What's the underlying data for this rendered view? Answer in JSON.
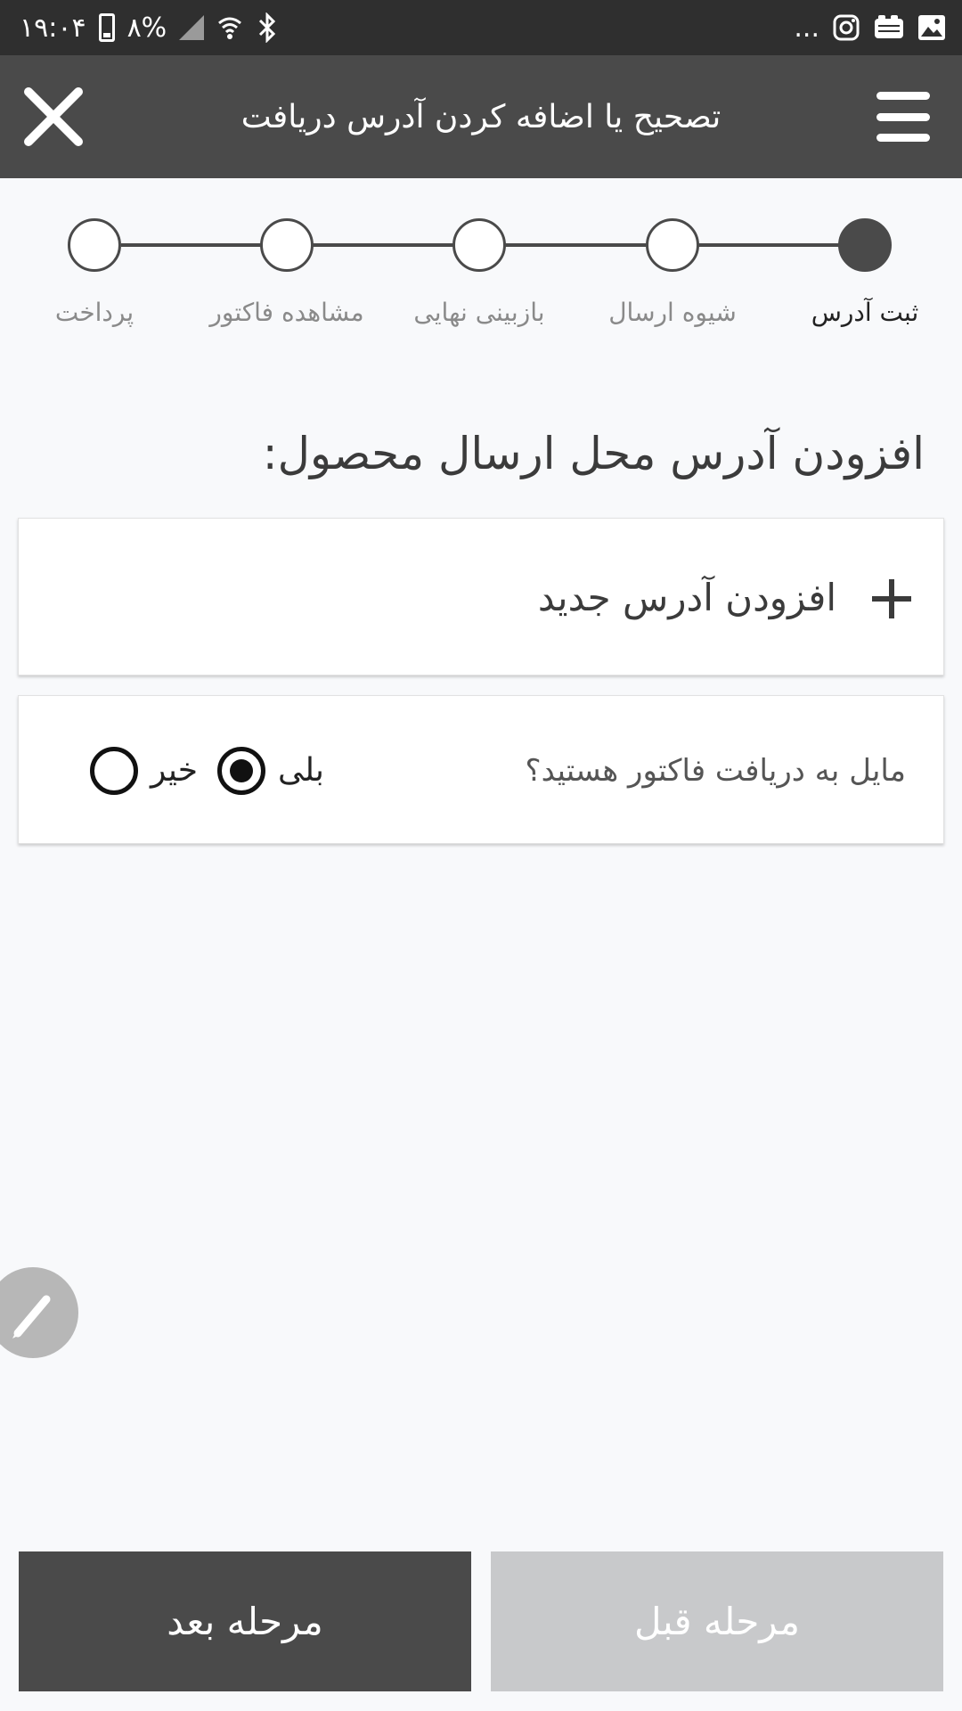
{
  "status_bar": {
    "time": "۱۹:۰۴",
    "battery": "۸%",
    "overflow": "..."
  },
  "app_bar": {
    "title": "تصحیح یا اضافه کردن آدرس دریافت"
  },
  "stepper": {
    "steps": [
      {
        "label": "ثبت آدرس",
        "active": true
      },
      {
        "label": "شیوه ارسال",
        "active": false
      },
      {
        "label": "بازبینی نهایی",
        "active": false
      },
      {
        "label": "مشاهده فاکتور",
        "active": false
      },
      {
        "label": "پرداخت",
        "active": false
      }
    ]
  },
  "main": {
    "heading": "افزودن آدرس محل ارسال محصول:",
    "add_address_label": "افزودن آدرس جدید",
    "invoice_question": "مایل به دریافت فاکتور هستید؟",
    "invoice_options": [
      {
        "label": "بلی",
        "selected": true
      },
      {
        "label": "خیر",
        "selected": false
      }
    ]
  },
  "footer": {
    "next_label": "مرحله بعد",
    "prev_label": "مرحله قبل"
  },
  "colors": {
    "app_bar": "#4a4a4a",
    "status_bar": "#2f2f2f",
    "background": "#f8f9fb",
    "disabled_button": "#c8c9cb"
  }
}
